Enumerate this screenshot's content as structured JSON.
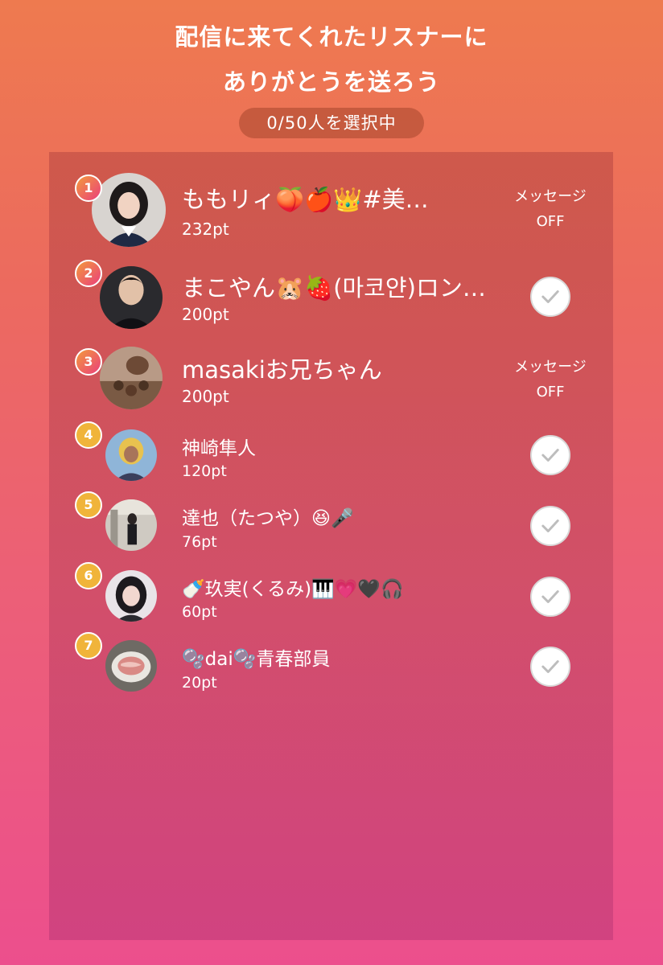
{
  "header": {
    "title_line1": "配信に来てくれたリスナーに",
    "title_line2": "ありがとうを送ろう",
    "selection_counter": "0/50人を選択中"
  },
  "listeners": [
    {
      "rank": "1",
      "name": "ももリィ🍑🍎👑#美…",
      "points": "232pt",
      "status": "message_off",
      "message_label": "メッセージ",
      "off_label": "OFF"
    },
    {
      "rank": "2",
      "name": "まこやん🐹🍓(마코얀)ロン…",
      "points": "200pt",
      "status": "checkbox"
    },
    {
      "rank": "3",
      "name": "masakiお兄ちゃん",
      "points": "200pt",
      "status": "message_off",
      "message_label": "メッセージ",
      "off_label": "OFF"
    },
    {
      "rank": "4",
      "name": "神崎隼人",
      "points": "120pt",
      "status": "checkbox"
    },
    {
      "rank": "5",
      "name": "達也（たつや）😆🎤",
      "points": "76pt",
      "status": "checkbox"
    },
    {
      "rank": "6",
      "name": "🍼玖実(くるみ)🎹💗🖤🎧",
      "points": "60pt",
      "status": "checkbox"
    },
    {
      "rank": "7",
      "name": "🫧dai🫧青春部員",
      "points": "20pt",
      "status": "checkbox"
    }
  ],
  "icons": {
    "checkbox": "check-icon",
    "avatar": "avatar-photo"
  },
  "colors": {
    "background_top": "#ee7a4f",
    "background_bottom": "#ec4f8d",
    "rank_top3_from": "#f39a3c",
    "rank_top3_to": "#ea3f7c",
    "rank_other": "#f0b43a",
    "checkmark": "#bdbdbd"
  }
}
